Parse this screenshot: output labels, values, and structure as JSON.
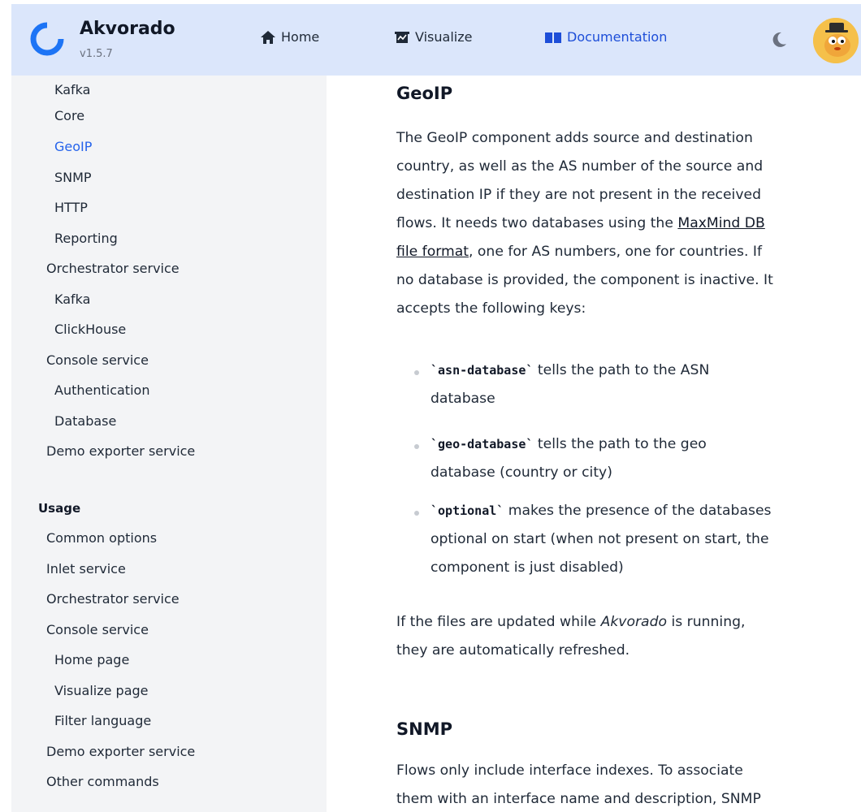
{
  "header": {
    "brand_title": "Akvorado",
    "brand_version": "v1.5.7",
    "nav": [
      {
        "label": "Home"
      },
      {
        "label": "Visualize"
      },
      {
        "label": "Documentation"
      }
    ]
  },
  "sidebar": {
    "items_top": [
      {
        "label": "Kafka"
      },
      {
        "label": "Core"
      },
      {
        "label": "GeoIP"
      },
      {
        "label": "SNMP"
      },
      {
        "label": "HTTP"
      },
      {
        "label": "Reporting"
      },
      {
        "label": "Orchestrator service"
      },
      {
        "label": "Kafka"
      },
      {
        "label": "ClickHouse"
      },
      {
        "label": "Console service"
      },
      {
        "label": "Authentication"
      },
      {
        "label": "Database"
      },
      {
        "label": "Demo exporter service"
      }
    ],
    "usage_heading": "Usage",
    "items_usage": [
      {
        "label": "Common options"
      },
      {
        "label": "Inlet service"
      },
      {
        "label": "Orchestrator service"
      },
      {
        "label": "Console service"
      },
      {
        "label": "Home page"
      },
      {
        "label": "Visualize page"
      },
      {
        "label": "Filter language"
      },
      {
        "label": "Demo exporter service"
      },
      {
        "label": "Other commands"
      }
    ]
  },
  "content": {
    "geoip_title": "GeoIP",
    "geoip_p1_a": "The GeoIP component adds source and destination",
    "geoip_p1_b": "country, as well as the AS number of the source and",
    "geoip_p1_c": "destination IP if they are not present in the received",
    "geoip_p1_d": "flows. It needs two databases using the ",
    "geoip_link_1": "MaxMind DB",
    "geoip_link_2": "file format",
    "geoip_p1_e": ", one for AS numbers, one for countries. If",
    "geoip_p1_f": "no database is provided, the component is inactive. It",
    "geoip_p1_g": "accepts the following keys:",
    "keys": [
      {
        "code": "`asn-database`",
        "text_a": " tells the path to the ASN",
        "text_b": "database"
      },
      {
        "code": "`geo-database`",
        "text_a": " tells the path to the geo",
        "text_b": "database (country or city)"
      },
      {
        "code": "`optional`",
        "text_a": " makes the presence of the databases",
        "text_b": "optional on start (when not present on start, the",
        "text_c": "component is just disabled)"
      }
    ],
    "geoip_p2_a": "If the files are updated while ",
    "geoip_p2_em": "Akvorado",
    "geoip_p2_b": " is running,",
    "geoip_p2_c": "they are automatically refreshed.",
    "snmp_title": "SNMP",
    "snmp_p1_a": "Flows only include interface indexes. To associate",
    "snmp_p1_b": "them with an interface name and description, SNMP"
  }
}
